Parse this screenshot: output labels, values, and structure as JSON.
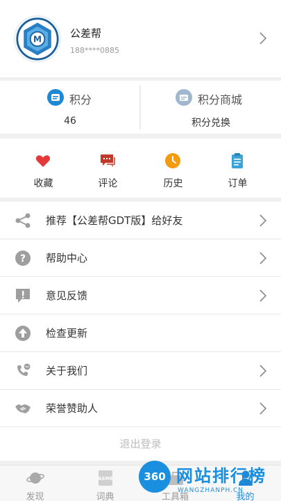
{
  "profile": {
    "name": "公差帮",
    "phone": "188****0885"
  },
  "points": {
    "score_label": "积分",
    "score_value": "46",
    "mall_label": "积分商城",
    "mall_action": "积分兑换"
  },
  "quick_actions": [
    {
      "label": "收藏",
      "icon": "heart-icon",
      "color": "#e5383b"
    },
    {
      "label": "评论",
      "icon": "comment-icon",
      "color": "#c0392b"
    },
    {
      "label": "历史",
      "icon": "clock-icon",
      "color": "#f39c12"
    },
    {
      "label": "订单",
      "icon": "clipboard-icon",
      "color": "#3aa3d8"
    }
  ],
  "menu": [
    {
      "label": "推荐【公差帮GDT版】给好友",
      "icon": "share-icon"
    },
    {
      "label": "帮助中心",
      "icon": "help-icon"
    },
    {
      "label": "意见反馈",
      "icon": "feedback-icon"
    },
    {
      "label": "检查更新",
      "icon": "update-icon"
    },
    {
      "label": "关于我们",
      "icon": "phone-chat-icon"
    },
    {
      "label": "荣誉赞助人",
      "icon": "handshake-icon"
    }
  ],
  "logout_label": "退出登录",
  "tabs": [
    {
      "label": "发现",
      "icon": "planet-icon",
      "active": false
    },
    {
      "label": "词典",
      "icon": "asme-icon",
      "active": false,
      "icon_text": "ASME"
    },
    {
      "label": "工具箱",
      "icon": "toolbox-icon",
      "active": false
    },
    {
      "label": "我的",
      "icon": "person-icon",
      "active": true
    }
  ],
  "watermark": {
    "badge": "360",
    "title": "网站排行榜",
    "subtitle": "WANGZHANPH.CN"
  },
  "colors": {
    "accent": "#1e88d2",
    "points_icon": "#1e88d2",
    "mall_icon": "#9fb8cf"
  }
}
